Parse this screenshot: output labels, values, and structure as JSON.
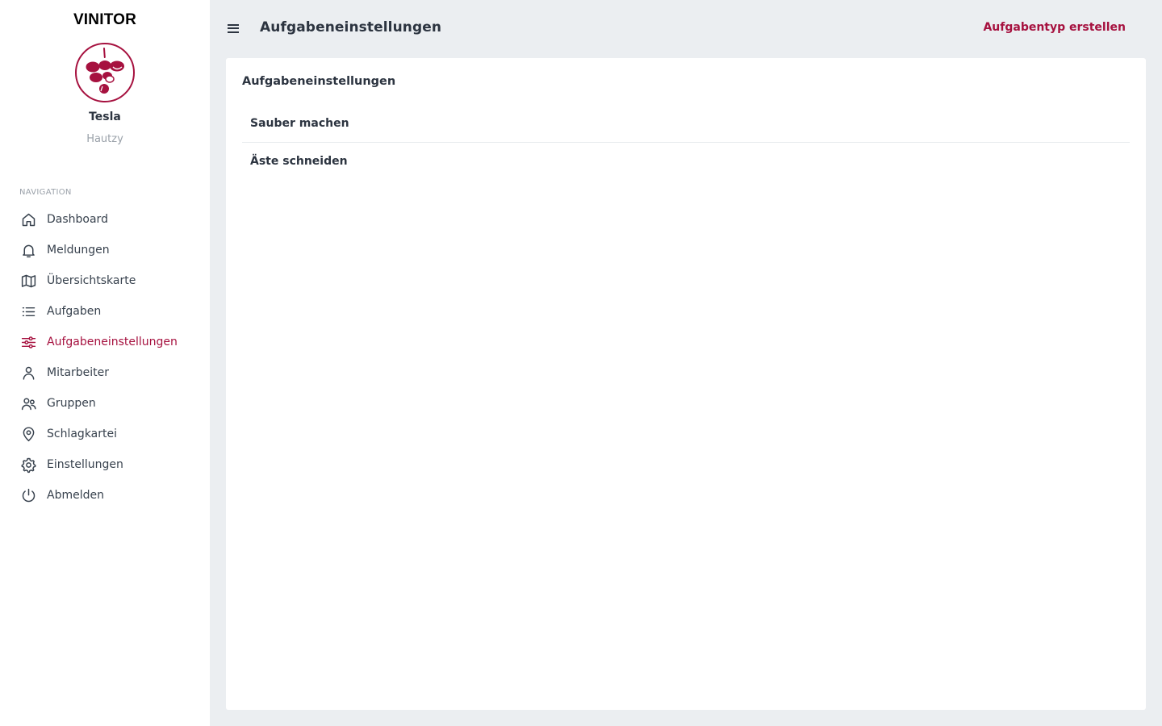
{
  "brand": "VINITOR",
  "user": {
    "name": "Tesla",
    "subtitle": "Hautzy"
  },
  "sidebar": {
    "heading": "NAVIGATION",
    "items": [
      {
        "label": "Dashboard",
        "icon": "home-icon"
      },
      {
        "label": "Meldungen",
        "icon": "bell-icon"
      },
      {
        "label": "Übersichtskarte",
        "icon": "map-icon"
      },
      {
        "label": "Aufgaben",
        "icon": "list-icon"
      },
      {
        "label": "Aufgabeneinstellungen",
        "icon": "sliders-icon",
        "active": true
      },
      {
        "label": "Mitarbeiter",
        "icon": "person-icon"
      },
      {
        "label": "Gruppen",
        "icon": "people-icon"
      },
      {
        "label": "Schlagkartei",
        "icon": "map-pin-icon"
      },
      {
        "label": "Einstellungen",
        "icon": "gear-icon"
      },
      {
        "label": "Abmelden",
        "icon": "power-icon"
      }
    ]
  },
  "header": {
    "title": "Aufgabeneinstellungen",
    "action_label": "Aufgabentyp erstellen"
  },
  "card": {
    "title": "Aufgabeneinstellungen",
    "tasks": [
      "Sauber machen",
      "Äste schneiden"
    ]
  },
  "colors": {
    "accent": "#a6113f",
    "background": "#ebeef1",
    "text": "#2c3440",
    "muted": "#9aa1a9"
  }
}
